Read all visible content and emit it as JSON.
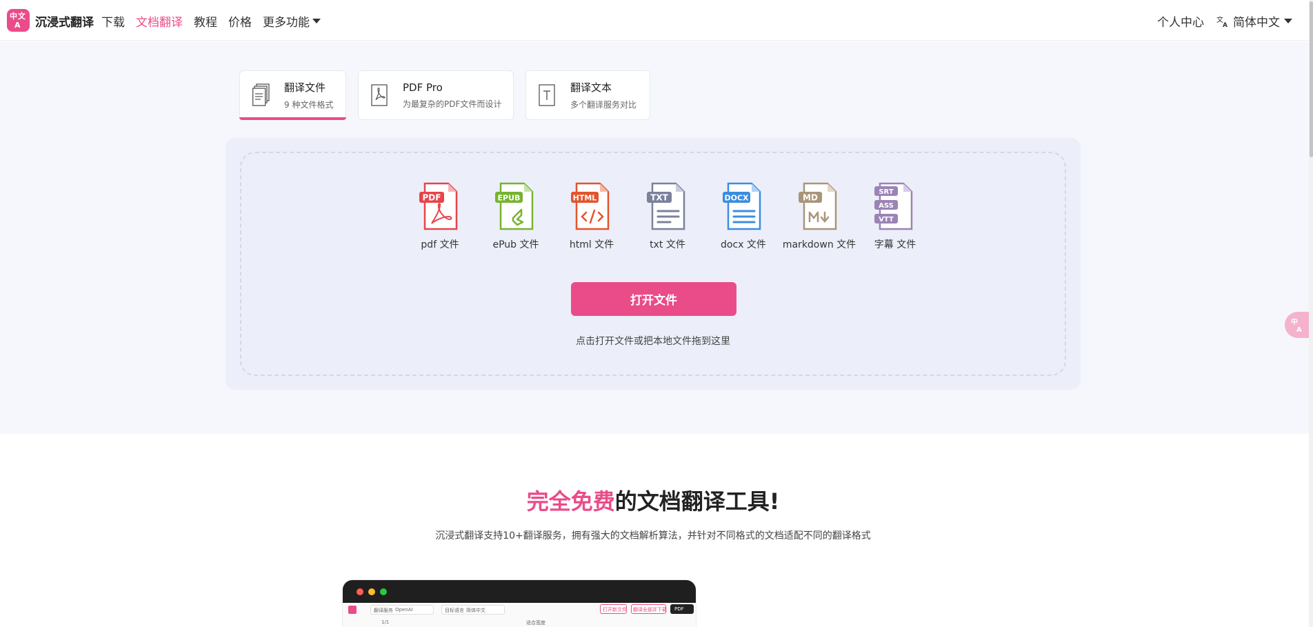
{
  "header": {
    "logo_text": "中文A",
    "brand": "沉浸式翻译",
    "nav": [
      "下载",
      "文档翻译",
      "教程",
      "价格",
      "更多功能"
    ],
    "active_nav": "文档翻译",
    "profile": "个人中心",
    "language": "简体中文"
  },
  "tabs": [
    {
      "title": "翻译文件",
      "subtitle": "9 种文件格式",
      "icon": "document-stack-icon",
      "active": true
    },
    {
      "title": "PDF Pro",
      "subtitle": "为最复杂的PDF文件而设计",
      "icon": "pdf-icon",
      "active": false
    },
    {
      "title": "翻译文本",
      "subtitle": "多个翻译服务对比",
      "icon": "text-icon",
      "active": false
    }
  ],
  "formats": [
    {
      "badge": "PDF",
      "label": "pdf 文件",
      "color": "#e5454b"
    },
    {
      "badge": "EPUB",
      "label": "ePub 文件",
      "color": "#76b32f"
    },
    {
      "badge": "HTML",
      "label": "html 文件",
      "color": "#e2542c"
    },
    {
      "badge": "TXT",
      "label": "txt 文件",
      "color": "#7a819b"
    },
    {
      "badge": "DOCX",
      "label": "docx 文件",
      "color": "#3b8de0"
    },
    {
      "badge": "MD",
      "label": "markdown 文件",
      "color": "#a8957a"
    },
    {
      "badge": "SRT ASS VTT",
      "label": "字幕 文件",
      "color": "#9b83b5"
    }
  ],
  "dropzone": {
    "button": "打开文件",
    "hint": "点击打开文件或把本地文件拖到这里"
  },
  "section": {
    "headline_pink": "完全免费",
    "headline_rest": "的文档翻译工具!",
    "subline": "沉浸式翻译支持10+翻译服务，拥有强大的文档解析算法，并针对不同格式的文档适配不同的翻译格式"
  },
  "preview": {
    "service_label": "翻译服务",
    "service_value": "OpenAI",
    "target_label": "目标语言",
    "target_value": "简体中文",
    "btn1": "打开新文件",
    "btn2": "翻译全部并下载",
    "btn3": "PDF",
    "page": "1/1",
    "zoom": "适合宽度"
  },
  "colors": {
    "accent": "#ea4c89",
    "bg": "#f5f7fc"
  }
}
